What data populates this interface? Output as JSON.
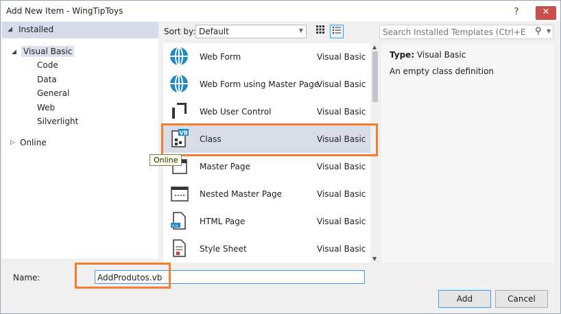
{
  "window": {
    "title": "Add New Item - WingTipToys",
    "help_label": "?",
    "close_label": "✕"
  },
  "tree": {
    "installed": "Installed",
    "visual_basic": "Visual Basic",
    "children": [
      "Code",
      "Data",
      "General",
      "Web",
      "Silverlight"
    ],
    "online": "Online"
  },
  "toolbar": {
    "sort_label": "Sort by:",
    "sort_value": "Default",
    "search_placeholder": "Search Installed Templates (Ctrl+E)"
  },
  "templates": [
    {
      "name": "Web Form",
      "type": "Visual Basic",
      "icon": "globe-icon"
    },
    {
      "name": "Web Form using Master Page",
      "type": "Visual Basic",
      "icon": "globe-icon"
    },
    {
      "name": "Web User Control",
      "type": "Visual Basic",
      "icon": "user-control-icon"
    },
    {
      "name": "Class",
      "type": "Visual Basic",
      "icon": "vb-class-icon",
      "selected": true
    },
    {
      "name": "Master Page",
      "type": "Visual Basic",
      "icon": "master-page-icon"
    },
    {
      "name": "Nested Master Page",
      "type": "Visual Basic",
      "icon": "nested-master-page-icon"
    },
    {
      "name": "HTML Page",
      "type": "Visual Basic",
      "icon": "html-page-icon"
    },
    {
      "name": "Style Sheet",
      "type": "Visual Basic",
      "icon": "style-sheet-icon"
    }
  ],
  "details": {
    "type_label": "Type:",
    "type_value": "Visual Basic",
    "description": "An empty class definition"
  },
  "tooltip": "Online",
  "name_field": {
    "label": "Name:",
    "value": "AddProdutos.vb"
  },
  "buttons": {
    "add": "Add",
    "cancel": "Cancel"
  },
  "colors": {
    "highlight": "#f57c2b",
    "selection": "#d8dce6",
    "focus": "#3399ff"
  }
}
